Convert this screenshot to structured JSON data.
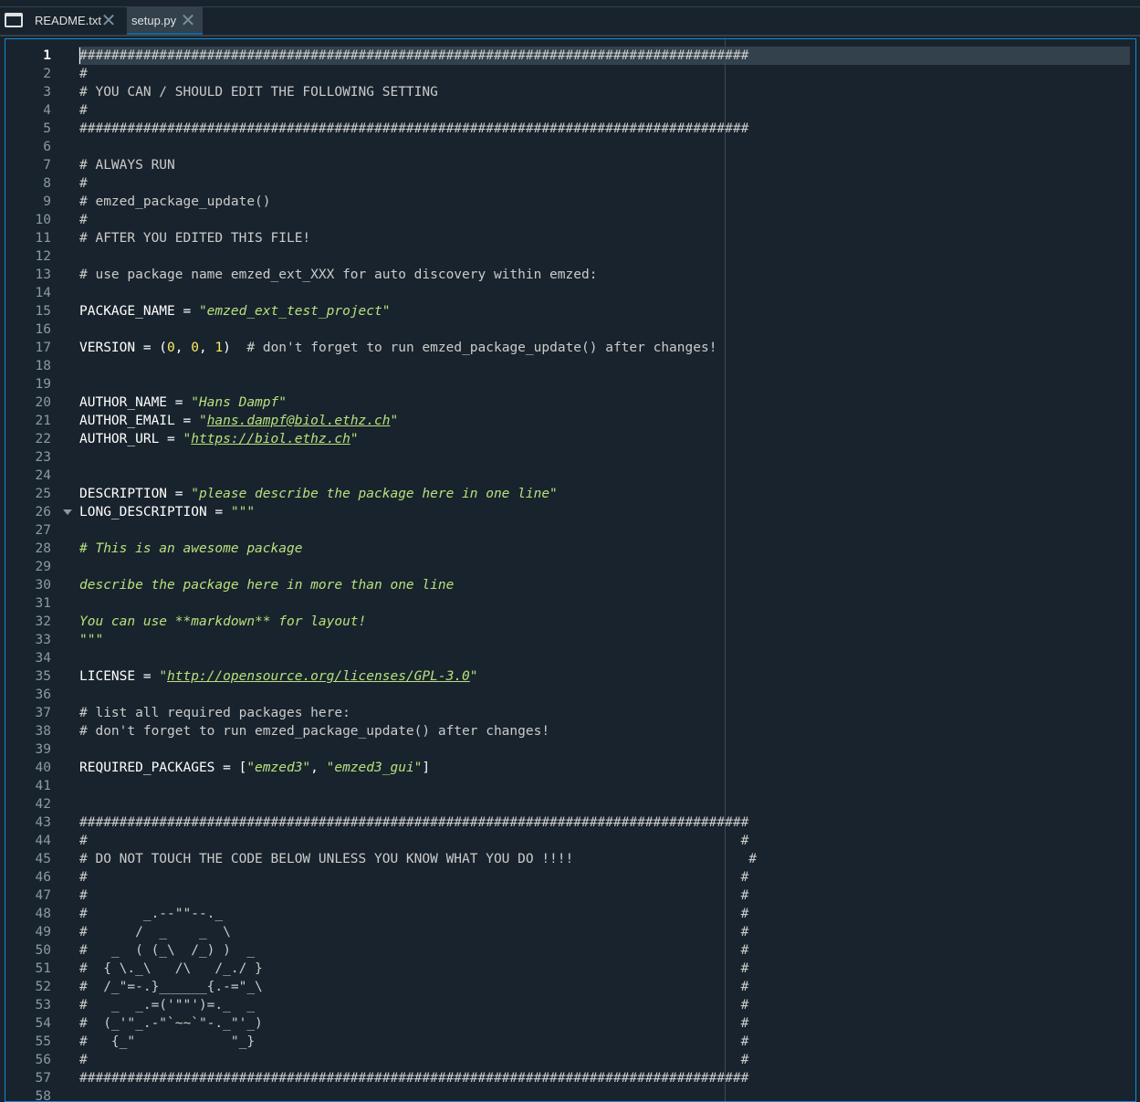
{
  "tabs": [
    {
      "label": "README.txt",
      "active": false
    },
    {
      "label": "setup.py",
      "active": true
    }
  ],
  "icons": {
    "window": "window-icon",
    "close": "close-icon",
    "fold": "fold-arrow-icon"
  },
  "close_glyph": "✕",
  "current_line": 1,
  "line_count": 58,
  "fold_line": 26,
  "colors": {
    "background": "#19232d",
    "comment": "#cbcbcb",
    "string": "#b7e17d",
    "number": "#faed5c",
    "current_line_bg": "#32414b",
    "accent": "#148cd2"
  },
  "lines": [
    [
      [
        "c",
        "####################################################################################"
      ]
    ],
    [
      [
        "c",
        "#"
      ]
    ],
    [
      [
        "c",
        "# YOU CAN / SHOULD EDIT THE FOLLOWING SETTING"
      ]
    ],
    [
      [
        "c",
        "#"
      ]
    ],
    [
      [
        "c",
        "####################################################################################"
      ]
    ],
    [],
    [
      [
        "c",
        "# ALWAYS RUN"
      ]
    ],
    [
      [
        "c",
        "#"
      ]
    ],
    [
      [
        "c",
        "# emzed_package_update()"
      ]
    ],
    [
      [
        "c",
        "#"
      ]
    ],
    [
      [
        "c",
        "# AFTER YOU EDITED THIS FILE!"
      ]
    ],
    [],
    [
      [
        "c",
        "# use package name emzed_ext_XXX for auto discovery within emzed:"
      ]
    ],
    [],
    [
      [
        "o",
        "PACKAGE_NAME = "
      ],
      [
        "s",
        "\"emzed_ext_test_project\""
      ]
    ],
    [],
    [
      [
        "o",
        "VERSION = ("
      ],
      [
        "n",
        "0"
      ],
      [
        "o",
        ", "
      ],
      [
        "n",
        "0"
      ],
      [
        "o",
        ", "
      ],
      [
        "n",
        "1"
      ],
      [
        "o",
        ")  "
      ],
      [
        "c",
        "# don't forget to run emzed_package_update() after changes!"
      ]
    ],
    [],
    [],
    [
      [
        "o",
        "AUTHOR_NAME = "
      ],
      [
        "s",
        "\"Hans Dampf\""
      ]
    ],
    [
      [
        "o",
        "AUTHOR_EMAIL = "
      ],
      [
        "s",
        "\""
      ],
      [
        "su",
        "hans.dampf@biol.ethz.ch"
      ],
      [
        "s",
        "\""
      ]
    ],
    [
      [
        "o",
        "AUTHOR_URL = "
      ],
      [
        "s",
        "\""
      ],
      [
        "su",
        "https://biol.ethz.ch"
      ],
      [
        "s",
        "\""
      ]
    ],
    [],
    [],
    [
      [
        "o",
        "DESCRIPTION = "
      ],
      [
        "s",
        "\"please describe the package here in one line\""
      ]
    ],
    [
      [
        "o",
        "LONG_DESCRIPTION = "
      ],
      [
        "s",
        "\"\"\""
      ]
    ],
    [],
    [
      [
        "s",
        "# This is an awesome package"
      ]
    ],
    [],
    [
      [
        "s",
        "describe the package here in more than one line"
      ]
    ],
    [],
    [
      [
        "s",
        "You can use **markdown** for layout!"
      ]
    ],
    [
      [
        "s",
        "\"\"\""
      ]
    ],
    [],
    [
      [
        "o",
        "LICENSE = "
      ],
      [
        "s",
        "\""
      ],
      [
        "su",
        "http://opensource.org/licenses/GPL-3.0"
      ],
      [
        "s",
        "\""
      ]
    ],
    [],
    [
      [
        "c",
        "# list all required packages here:"
      ]
    ],
    [
      [
        "c",
        "# don't forget to run emzed_package_update() after changes!"
      ]
    ],
    [],
    [
      [
        "o",
        "REQUIRED_PACKAGES = ["
      ],
      [
        "s",
        "\"emzed3\""
      ],
      [
        "o",
        ", "
      ],
      [
        "s",
        "\"emzed3_gui\""
      ],
      [
        "o",
        "]"
      ]
    ],
    [],
    [],
    [
      [
        "c",
        "####################################################################################"
      ]
    ],
    [
      [
        "c",
        "#                                                                                  #"
      ]
    ],
    [
      [
        "c",
        "# DO NOT TOUCH THE CODE BELOW UNLESS YOU KNOW WHAT YOU DO !!!!                      #"
      ]
    ],
    [
      [
        "c",
        "#                                                                                  #"
      ]
    ],
    [
      [
        "c",
        "#                                                                                  #"
      ]
    ],
    [
      [
        "c",
        "#       _.--\"\"--._                                                                 #"
      ]
    ],
    [
      [
        "c",
        "#      /  _    _  \\                                                                #"
      ]
    ],
    [
      [
        "c",
        "#   _  ( (_\\  /_) )  _                                                             #"
      ]
    ],
    [
      [
        "c",
        "#  { \\._\\   /\\   /_./ }                                                            #"
      ]
    ],
    [
      [
        "c",
        "#  /_\"=-.}______{.-=\"_\\                                                            #"
      ]
    ],
    [
      [
        "c",
        "#   _  _.=('\"\"')=._  _                                                             #"
      ]
    ],
    [
      [
        "c",
        "#  (_'\"_.-\"`~~`\"-._\"'_)                                                            #"
      ]
    ],
    [
      [
        "c",
        "#   {_\"            \"_}                                                             #"
      ]
    ],
    [
      [
        "c",
        "#                                                                                  #"
      ]
    ],
    [
      [
        "c",
        "####################################################################################"
      ]
    ],
    []
  ]
}
